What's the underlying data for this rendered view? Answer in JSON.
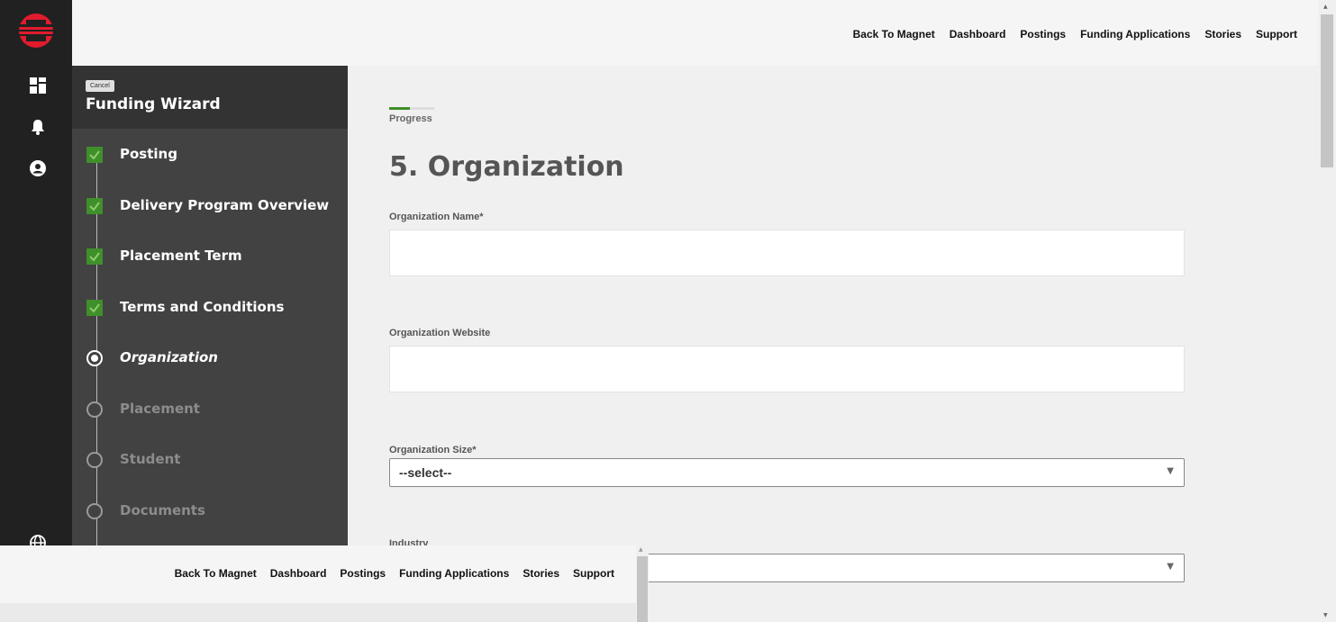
{
  "topnav": [
    "Back To Magnet",
    "Dashboard",
    "Postings",
    "Funding Applications",
    "Stories",
    "Support"
  ],
  "wizard": {
    "cancel_label": "Cancel",
    "title": "Funding Wizard",
    "steps": [
      {
        "label": "Posting",
        "status": "done"
      },
      {
        "label": "Delivery Program Overview",
        "status": "done"
      },
      {
        "label": "Placement Term",
        "status": "done"
      },
      {
        "label": "Terms and Conditions",
        "status": "done"
      },
      {
        "label": "Organization",
        "status": "current"
      },
      {
        "label": "Placement",
        "status": "todo"
      },
      {
        "label": "Student",
        "status": "todo"
      },
      {
        "label": "Documents",
        "status": "todo"
      }
    ]
  },
  "main": {
    "progress_label": "Progress",
    "progress_fraction": 0.45,
    "page_title": "5. Organization",
    "fields": {
      "org_name_label": "Organization Name*",
      "org_name_value": "",
      "org_website_label": "Organization Website",
      "org_website_value": "",
      "org_size_label": "Organization Size*",
      "org_size_value": "--select--",
      "industry_label": "Industry",
      "industry_value": ""
    }
  },
  "bottomnav": [
    "Back To Magnet",
    "Dashboard",
    "Postings",
    "Funding Applications",
    "Stories",
    "Support"
  ],
  "colors": {
    "rail": "#212121",
    "wizard_bg": "#424242",
    "wizard_header": "#333333",
    "accent_green": "#3f8f2a",
    "logo_red": "#e21b2d"
  }
}
